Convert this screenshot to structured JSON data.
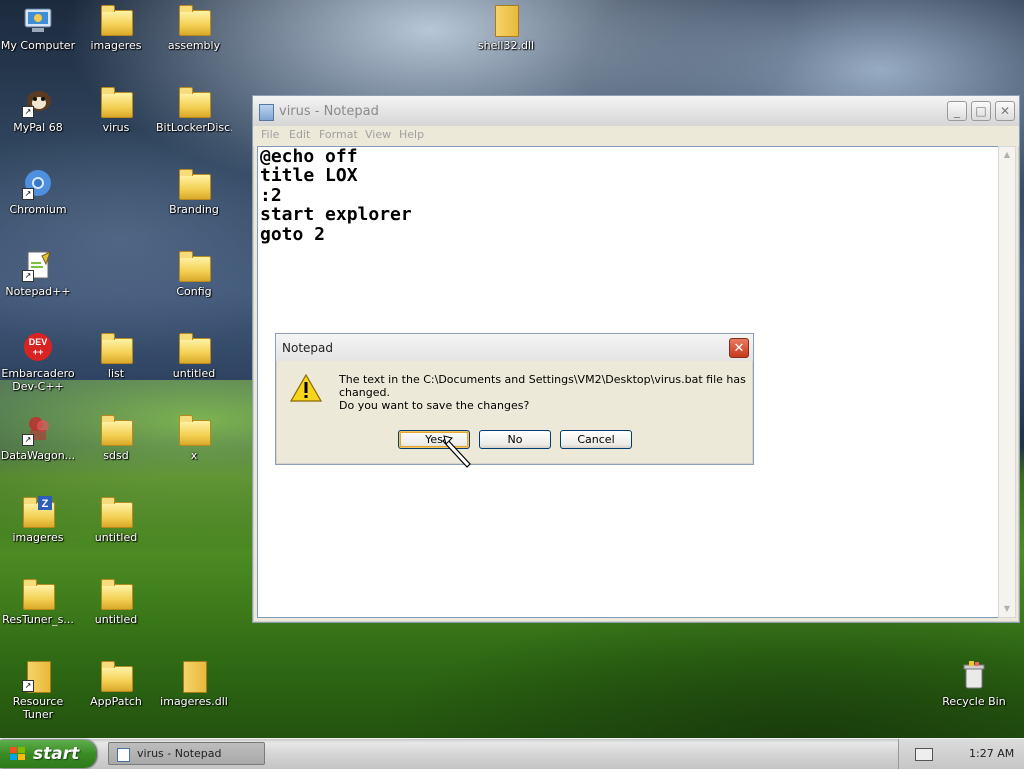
{
  "desktop": {
    "icons": [
      {
        "label": "My Computer",
        "icon": "my-computer-icon"
      },
      {
        "label": "imageres",
        "icon": "folder-icon"
      },
      {
        "label": "assembly",
        "icon": "folder-icon"
      },
      {
        "label": "shell32.dll",
        "icon": "file-icon"
      },
      {
        "label": "MyPal 68",
        "icon": "mypal-browser-icon"
      },
      {
        "label": "virus",
        "icon": "folder-icon"
      },
      {
        "label": "BitLockerDisc...",
        "icon": "folder-icon"
      },
      {
        "label": "Chromium",
        "icon": "chromium-icon"
      },
      {
        "label": "Branding",
        "icon": "folder-icon"
      },
      {
        "label": "Notepad++",
        "icon": "notepad-plus-plus-icon"
      },
      {
        "label": "Config",
        "icon": "folder-icon"
      },
      {
        "label": "Embarcadero Dev-C++",
        "icon": "dev-cpp-icon"
      },
      {
        "label": "list",
        "icon": "folder-icon"
      },
      {
        "label": "untitled",
        "icon": "folder-icon"
      },
      {
        "label": "DataWagon...",
        "icon": "datawagon-icon"
      },
      {
        "label": "sdsd",
        "icon": "folder-icon"
      },
      {
        "label": "x",
        "icon": "folder-icon"
      },
      {
        "label": "imageres",
        "icon": "folder-icon"
      },
      {
        "label": "untitled",
        "icon": "folder-icon"
      },
      {
        "label": "ResTuner_s...",
        "icon": "folder-icon"
      },
      {
        "label": "untitled",
        "icon": "folder-icon"
      },
      {
        "label": "Resource Tuner",
        "icon": "resource-tuner-icon"
      },
      {
        "label": "AppPatch",
        "icon": "folder-icon"
      },
      {
        "label": "imageres.dll",
        "icon": "file-icon"
      },
      {
        "label": "Recycle Bin",
        "icon": "recycle-bin-icon"
      }
    ]
  },
  "notepad": {
    "title": "virus - Notepad",
    "menu": [
      "File",
      "Edit",
      "Format",
      "View",
      "Help"
    ],
    "content": "@echo off\ntitle LOX\n:2\nstart explorer\ngoto 2",
    "controls": {
      "minimize": "_",
      "maximize": "□",
      "close": "✕"
    }
  },
  "dialog": {
    "title": "Notepad",
    "icon": "warning-icon",
    "message_line1": "The text in the C:\\Documents and Settings\\VM2\\Desktop\\virus.bat file has changed.",
    "message_line2": "Do you want to save the changes?",
    "buttons": {
      "yes": "Yes",
      "no": "No",
      "cancel": "Cancel"
    },
    "close": "✕"
  },
  "taskbar": {
    "start_label": "start",
    "tasks": [
      {
        "label": "virus - Notepad"
      }
    ],
    "clock": "1:27 AM"
  },
  "colors": {
    "start_green": "#3a8b25",
    "dialog_close_red": "#c6391c",
    "default_button_highlight": "#e6a632"
  }
}
